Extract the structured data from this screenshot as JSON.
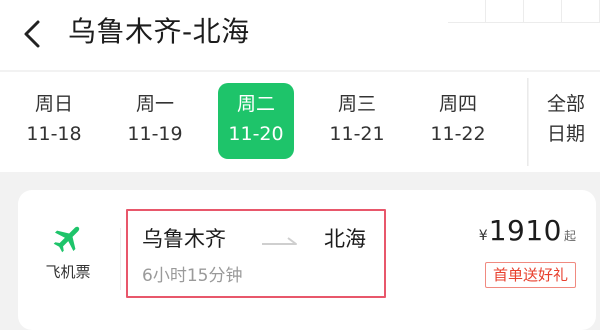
{
  "header": {
    "back_icon": "chevron-left-icon",
    "title": "乌鲁木齐-北海"
  },
  "datebar": {
    "items": [
      {
        "weekday": "周日",
        "date": "11-18",
        "selected": false
      },
      {
        "weekday": "周一",
        "date": "11-19",
        "selected": false
      },
      {
        "weekday": "周二",
        "date": "11-20",
        "selected": true
      },
      {
        "weekday": "周三",
        "date": "11-21",
        "selected": false
      },
      {
        "weekday": "周四",
        "date": "11-22",
        "selected": false
      }
    ],
    "all_dates_line1": "全部",
    "all_dates_line2": "日期"
  },
  "card": {
    "type_icon": "airplane-icon",
    "type_label": "飞机票",
    "from": "乌鲁木齐",
    "to": "北海",
    "duration": "6小时15分钟",
    "price_symbol": "¥",
    "price": "1910",
    "price_suffix": "起",
    "promo": "首单送好礼"
  },
  "colors": {
    "accent": "#1ec46a",
    "highlight_box": "#e8576b",
    "promo": "#e8402e"
  }
}
